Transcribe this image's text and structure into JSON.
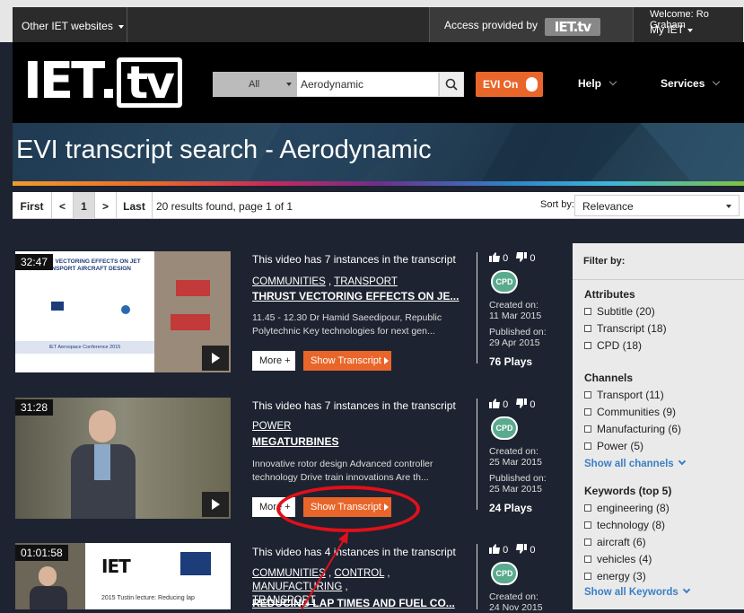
{
  "topbar": {
    "other_sites": "Other IET websites",
    "access_text": "Access provided by",
    "access_logo": "IET.tv",
    "welcome": "Welcome: Ro Graham",
    "my_iet": "My IET"
  },
  "header": {
    "logo_iet": "IET",
    "logo_tv": "tv",
    "search_category": "All",
    "search_value": "Aerodynamic",
    "evi_label": "EVI On",
    "help": "Help",
    "services": "Services"
  },
  "page_title": "EVI transcript search - Aerodynamic",
  "pager": {
    "first": "First",
    "prev": "<",
    "page": "1",
    "next": ">",
    "last": "Last",
    "results": "20 results found, page 1 of 1",
    "sort_label": "Sort by:",
    "sort_value": "Relevance"
  },
  "results": [
    {
      "duration": "32:47",
      "instances": "This video has 7 instances in the transcript",
      "tags": [
        "COMMUNITIES",
        "TRANSPORT"
      ],
      "title": "THRUST VECTORING EFFECTS ON JE...",
      "desc": "11.45 - 12.30 Dr Hamid Saeedipour, Republic Polytechnic Key technologies for next gen...",
      "likes": "0",
      "dislikes": "0",
      "created_label": "Created on:",
      "created": "11 Mar 2015",
      "published_label": "Published on:",
      "published": "29 Apr 2015",
      "plays": "76 Plays",
      "more": "More +",
      "show": "Show Transcript",
      "thumb_title": "THRUST VECTORING EFFECTS ON JET TRANSPORT AIRCRAFT DESIGN",
      "thumb_conf": "IET Aerospace Conference 2015"
    },
    {
      "duration": "31:28",
      "instances": "This video has 7 instances in the transcript",
      "tags": [
        "POWER"
      ],
      "title": "MEGATURBINES",
      "desc": "Innovative rotor design Advanced controller technology Drive train innovations Are th...",
      "likes": "0",
      "dislikes": "0",
      "created_label": "Created on:",
      "created": "25 Mar 2015",
      "published_label": "Published on:",
      "published": "25 Mar 2015",
      "plays": "24 Plays",
      "more": "More +",
      "show": "Show Transcript"
    },
    {
      "duration": "01:01:58",
      "instances": "This video has 4 instances in the transcript",
      "tags": [
        "COMMUNITIES",
        "CONTROL",
        "MANUFACTURING",
        "TRANSPORT"
      ],
      "title": "REDUCING LAP TIMES AND FUEL CO...",
      "likes": "0",
      "dislikes": "0",
      "created_label": "Created on:",
      "created": "24 Nov 2015",
      "thumb_title": "2015 Tustin lecture: Reducing lap"
    }
  ],
  "filter": {
    "title": "Filter by:",
    "attributes_heading": "Attributes",
    "attributes": [
      "Subtitle (20)",
      "Transcript (18)",
      "CPD (18)"
    ],
    "channels_heading": "Channels",
    "channels": [
      "Transport (11)",
      "Communities (9)",
      "Manufacturing (6)",
      "Power (5)"
    ],
    "show_channels": "Show all channels",
    "keywords_heading": "Keywords (top 5)",
    "keywords": [
      "engineering (8)",
      "technology (8)",
      "aircraft (6)",
      "vehicles (4)",
      "energy (3)"
    ],
    "show_keywords": "Show all Keywords"
  },
  "cpd_badge": "CPD",
  "colors": {
    "accent": "#e9662a",
    "link": "#3b7fc4",
    "annotation": "#e0101a"
  }
}
